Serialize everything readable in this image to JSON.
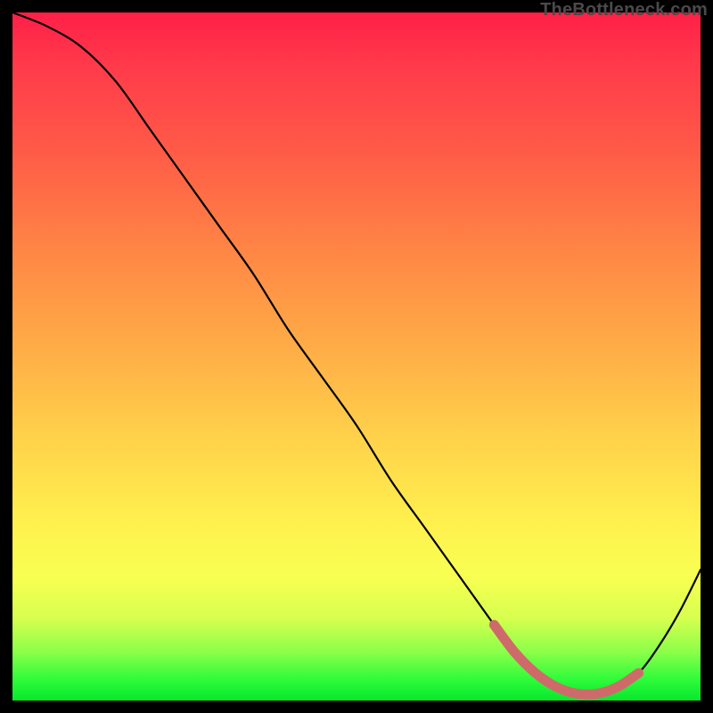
{
  "watermark": "TheBottleneck.com",
  "colors": {
    "curve": "#000000",
    "valley_marker": "#cf6a6a",
    "background_black": "#000000"
  },
  "chart_data": {
    "type": "line",
    "title": "",
    "xlabel": "",
    "ylabel": "",
    "xlim": [
      0,
      100
    ],
    "ylim": [
      0,
      100
    ],
    "grid": false,
    "legend": false,
    "note": "Axes are unlabeled; values are estimated from curve position within the plotted area. y=100 is top, y=0 is bottom.",
    "series": [
      {
        "name": "bottleneck-curve",
        "x": [
          0,
          5,
          10,
          15,
          20,
          25,
          30,
          35,
          40,
          45,
          50,
          55,
          60,
          65,
          70,
          73,
          76,
          79,
          82,
          85,
          88,
          91,
          94,
          97,
          100
        ],
        "y": [
          100,
          98,
          95,
          90,
          83,
          76,
          69,
          62,
          54,
          47,
          40,
          32,
          25,
          18,
          11,
          7,
          4,
          2,
          1,
          1,
          2,
          4,
          8,
          13,
          19
        ]
      }
    ],
    "valley_marker": {
      "description": "Thick pink segment drawn over bottom of the valley",
      "x": [
        70,
        73,
        76,
        79,
        82,
        85,
        88,
        91
      ],
      "y": [
        11,
        7,
        4,
        2,
        1,
        1,
        2,
        4
      ]
    }
  }
}
